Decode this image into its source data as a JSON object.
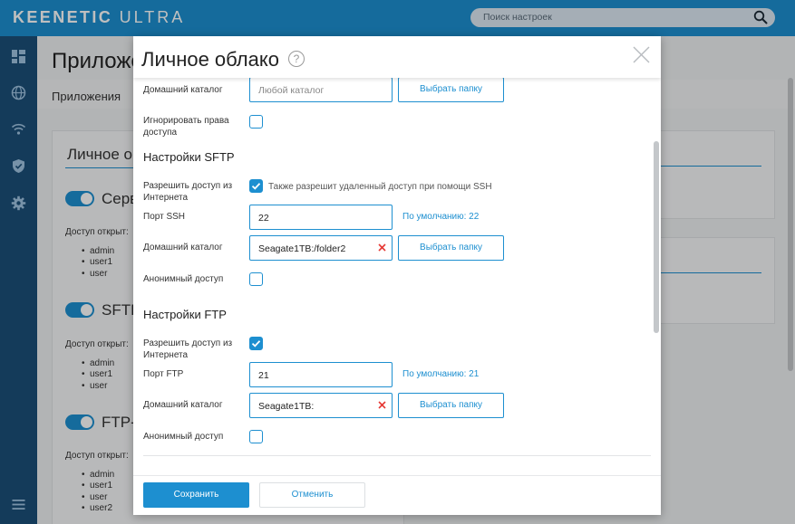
{
  "topbar": {
    "brand_bold": "KEENETIC",
    "brand_light": "ULTRA",
    "search_placeholder": "Поиск настроек"
  },
  "sidebar": {
    "icons": [
      "dashboard-icon",
      "globe-icon",
      "wifi-icon",
      "shield-icon",
      "gear-icon",
      "menu-icon"
    ]
  },
  "background": {
    "page_title": "Приложе",
    "tab": "Приложения",
    "card_title": "Личное о",
    "services": [
      {
        "name": "Серв",
        "access_label": "Доступ открыт:",
        "users": [
          "admin",
          "user1",
          "user"
        ]
      },
      {
        "name": "SFTP",
        "access_label": "Доступ открыт:",
        "users": [
          "admin",
          "user1",
          "user"
        ]
      },
      {
        "name": "FTP-",
        "access_label": "Доступ открыт:",
        "users": [
          "admin",
          "user1",
          "user",
          "user2"
        ]
      }
    ]
  },
  "modal": {
    "title": "Личное облако",
    "help": "?",
    "top": {
      "home_dir_label": "Домашний каталог",
      "home_dir_placeholder": "Любой каталог",
      "choose_folder": "Выбрать папку",
      "ignore_rights_label": "Игнорировать права доступа",
      "ignore_rights_checked": false
    },
    "sftp": {
      "heading": "Настройки SFTP",
      "allow_internet_label": "Разрешить доступ из Интернета",
      "allow_internet_checked": true,
      "allow_ssh_label": "Также разрешит удаленный доступ при помощи SSH",
      "port_label": "Порт SSH",
      "port_value": "22",
      "port_default": "По умолчанию: 22",
      "home_dir_label": "Домашний каталог",
      "home_dir_value": "Seagate1TB:/folder2",
      "choose_folder": "Выбрать папку",
      "anon_label": "Анонимный доступ",
      "anon_checked": false
    },
    "ftp": {
      "heading": "Настройки FTP",
      "allow_internet_label": "Разрешить доступ из Интернета",
      "allow_internet_checked": true,
      "port_label": "Порт FTP",
      "port_value": "21",
      "port_default": "По умолчанию: 21",
      "home_dir_label": "Домашний каталог",
      "home_dir_value": "Seagate1TB:",
      "choose_folder": "Выбрать папку",
      "anon_label": "Анонимный доступ",
      "anon_checked": false
    },
    "footer": {
      "save": "Сохранить",
      "cancel": "Отменить"
    }
  },
  "colors": {
    "accent": "#1d8fd0",
    "sidebar": "#1b4f79",
    "clear_icon": "#e53935"
  }
}
